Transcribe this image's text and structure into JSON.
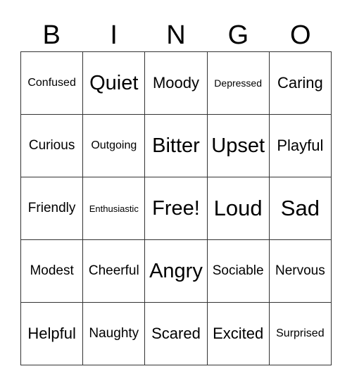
{
  "header": [
    "B",
    "I",
    "N",
    "G",
    "O"
  ],
  "rows": [
    [
      "Confused",
      "Quiet",
      "Moody",
      "Depressed",
      "Caring"
    ],
    [
      "Curious",
      "Outgoing",
      "Bitter",
      "Upset",
      "Playful"
    ],
    [
      "Friendly",
      "Enthusiastic",
      "Free!",
      "Loud",
      "Sad"
    ],
    [
      "Modest",
      "Cheerful",
      "Angry",
      "Sociable",
      "Nervous"
    ],
    [
      "Helpful",
      "Naughty",
      "Scared",
      "Excited",
      "Surprised"
    ]
  ]
}
